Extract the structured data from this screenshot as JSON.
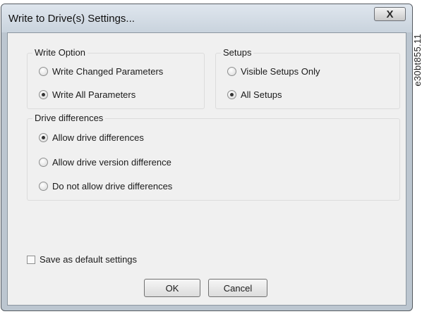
{
  "window": {
    "title": "Write to Drive(s) Settings...",
    "close_glyph": "X"
  },
  "write_option": {
    "label": "Write Option",
    "options": [
      {
        "label": "Write Changed Parameters",
        "checked": false
      },
      {
        "label": "Write All Parameters",
        "checked": true
      }
    ]
  },
  "setups": {
    "label": "Setups",
    "options": [
      {
        "label": "Visible Setups Only",
        "checked": false
      },
      {
        "label": "All Setups",
        "checked": true
      }
    ]
  },
  "drive_differences": {
    "label": "Drive differences",
    "options": [
      {
        "label": "Allow drive differences",
        "checked": true
      },
      {
        "label": "Allow drive version difference",
        "checked": false
      },
      {
        "label": "Do not allow drive differences",
        "checked": false
      }
    ]
  },
  "save_default": {
    "label": "Save as default settings",
    "checked": false
  },
  "buttons": {
    "ok": "OK",
    "cancel": "Cancel"
  },
  "figure_id": "e30bt855.11"
}
